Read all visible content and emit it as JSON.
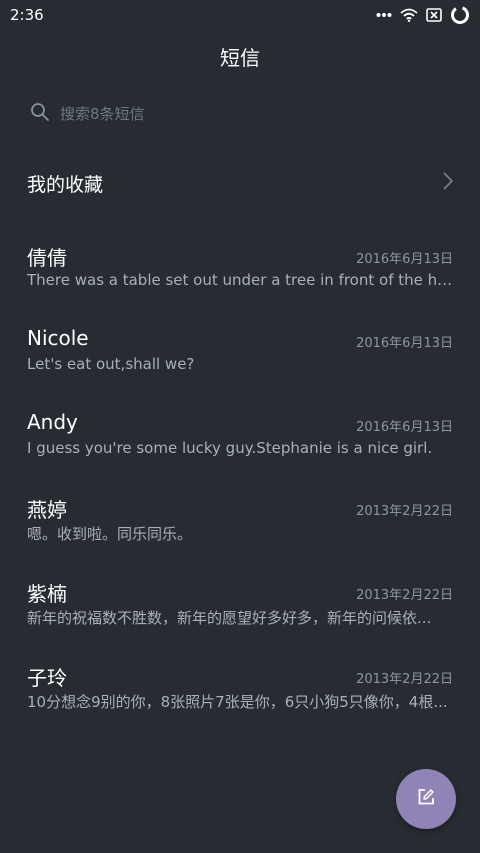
{
  "status_bar": {
    "time": "2:36",
    "icons": [
      "more-dots-icon",
      "wifi-icon",
      "no-sim-icon",
      "battery-ring-icon"
    ]
  },
  "header": {
    "title": "短信"
  },
  "search": {
    "placeholder": "搜索8条短信",
    "icon": "search-icon"
  },
  "favorites": {
    "label": "我的收藏",
    "icon": "chevron-right-icon"
  },
  "conversations": [
    {
      "name": "倩倩",
      "date": "2016年6月13日",
      "preview": "There was a table set out under a tree in front of the hous"
    },
    {
      "name": "Nicole",
      "date": "2016年6月13日",
      "preview": "Let's eat out,shall we?"
    },
    {
      "name": "Andy",
      "date": "2016年6月13日",
      "preview": "I guess you're some lucky guy.Stephanie is a nice girl."
    },
    {
      "name": "燕婷",
      "date": "2013年2月22日",
      "preview": "嗯。收到啦。同乐同乐。"
    },
    {
      "name": "紫楠",
      "date": "2013年2月22日",
      "preview": "新年的祝福数不胜数，新年的愿望好多好多，新年的问候依..."
    },
    {
      "name": "子玲",
      "date": "2013年2月22日",
      "preview": "10分想念9别的你，8张照片7张是你，6只小狗5只像你，4根..."
    }
  ],
  "fab": {
    "icon": "compose-icon",
    "color": "#8f84b5"
  },
  "colors": {
    "background": "#262c31",
    "date_text": "#8e979e",
    "preview_text": "#a9b1b7"
  }
}
